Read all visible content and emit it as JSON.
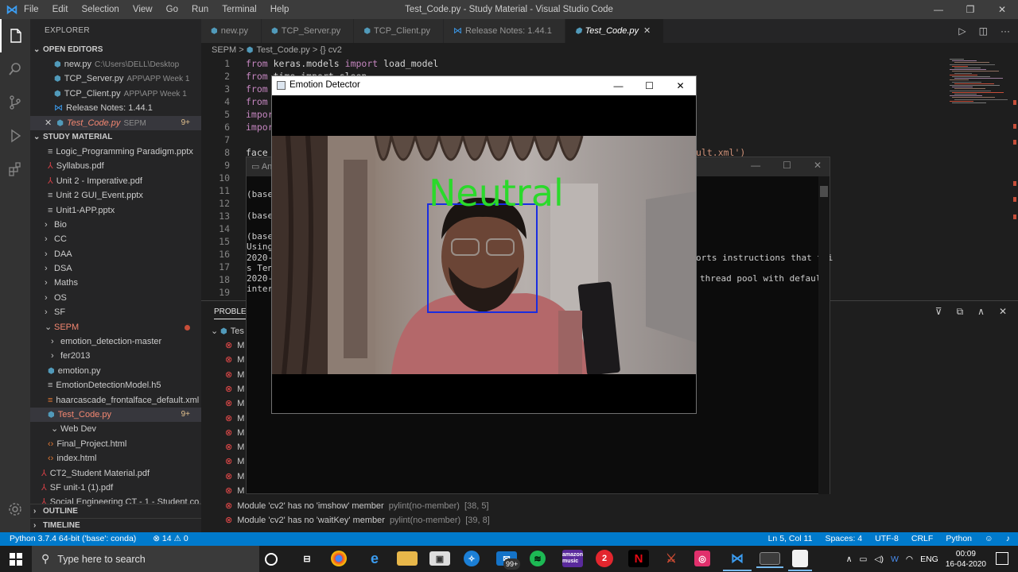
{
  "titlebar": {
    "menu": [
      "File",
      "Edit",
      "Selection",
      "View",
      "Go",
      "Run",
      "Terminal",
      "Help"
    ],
    "title": "Test_Code.py - Study Material - Visual Studio Code",
    "controls": [
      "—",
      "❐",
      "✕"
    ]
  },
  "activity": [
    "files-icon",
    "search-icon",
    "source-control-icon",
    "run-icon",
    "extensions-icon",
    "gear-icon"
  ],
  "sidebar": {
    "header": "EXPLORER",
    "open_editors_title": "OPEN EDITORS",
    "open_editors": [
      {
        "name": "new.py",
        "path": "C:\\Users\\DELL\\Desktop"
      },
      {
        "name": "TCP_Server.py",
        "path": "APP\\APP Week 1"
      },
      {
        "name": "TCP_Client.py",
        "path": "APP\\APP Week 1"
      },
      {
        "name": "Release Notes: 1.44.1",
        "path": ""
      },
      {
        "name": "Test_Code.py",
        "path": "SEPM",
        "badge": "9+"
      }
    ],
    "workspace_title": "STUDY MATERIAL",
    "tree": [
      {
        "label": "Logic_Programming Paradigm.pptx",
        "type": "file"
      },
      {
        "label": "Syllabus.pdf",
        "type": "pdf"
      },
      {
        "label": "Unit 2 - Imperative.pdf",
        "type": "pdf"
      },
      {
        "label": "Unit 2 GUI_Event.pptx",
        "type": "file"
      },
      {
        "label": "Unit1-APP.pptx",
        "type": "file"
      },
      {
        "label": "Bio",
        "type": "folder"
      },
      {
        "label": "CC",
        "type": "folder"
      },
      {
        "label": "DAA",
        "type": "folder"
      },
      {
        "label": "DSA",
        "type": "folder"
      },
      {
        "label": "Maths",
        "type": "folder"
      },
      {
        "label": "OS",
        "type": "folder"
      },
      {
        "label": "SF",
        "type": "folder"
      },
      {
        "label": "SEPM",
        "type": "folder-open"
      },
      {
        "label": "emotion_detection-master",
        "type": "subfolder"
      },
      {
        "label": "fer2013",
        "type": "subfolder"
      },
      {
        "label": "emotion.py",
        "type": "py"
      },
      {
        "label": "EmotionDetectionModel.h5",
        "type": "file"
      },
      {
        "label": "haarcascade_frontalface_default.xml",
        "type": "xml"
      },
      {
        "label": "Test_Code.py",
        "type": "py-sel",
        "badge": "9+"
      },
      {
        "label": "Web Dev",
        "type": "subfolder-open"
      },
      {
        "label": "Final_Project.html",
        "type": "html"
      },
      {
        "label": "index.html",
        "type": "html"
      },
      {
        "label": "CT2_Student Material.pdf",
        "type": "pdf-root"
      },
      {
        "label": "SF unit-1 (1).pdf",
        "type": "pdf-root"
      },
      {
        "label": "Social Engineering CT - 1 - Student co...",
        "type": "pdf-root"
      }
    ],
    "outline": "OUTLINE",
    "timeline": "TIMELINE"
  },
  "tabs": [
    {
      "label": "new.py",
      "icon": "python-icon"
    },
    {
      "label": "TCP_Server.py",
      "icon": "python-icon"
    },
    {
      "label": "TCP_Client.py",
      "icon": "python-icon"
    },
    {
      "label": "Release Notes: 1.44.1",
      "icon": "vscode-icon"
    },
    {
      "label": "Test_Code.py",
      "icon": "python-icon",
      "active": true
    }
  ],
  "breadcrumb": {
    "folder": "SEPM",
    "sep": ">",
    "file": "Test_Code.py",
    "symbol": "{} cv2"
  },
  "editor": {
    "lines": [
      {
        "n": "1",
        "kw": "from",
        "rest": " keras.models ",
        "kw2": "import",
        "rest2": " load_model"
      },
      {
        "n": "2",
        "kw": "from",
        "rest": " time import sleep",
        "kw2": "",
        "rest2": ""
      },
      {
        "n": "3",
        "kw": "from",
        "rest": "",
        "kw2": "",
        "rest2": ""
      },
      {
        "n": "4",
        "kw": "from",
        "rest": "",
        "kw2": "",
        "rest2": ""
      },
      {
        "n": "5",
        "kw": "import",
        "rest": "",
        "kw2": "",
        "rest2": ""
      },
      {
        "n": "6",
        "kw": "import",
        "rest": "",
        "kw2": "",
        "rest2": ""
      },
      {
        "n": "7",
        "kw": "",
        "rest": "",
        "kw2": "",
        "rest2": ""
      },
      {
        "n": "8",
        "kw": "",
        "rest": "face_",
        "kw2": "",
        "rest2": "",
        "str": "ult.xml')"
      },
      {
        "n": "9",
        "kw": "",
        "rest": "",
        "kw2": "",
        "rest2": ""
      },
      {
        "n": "10",
        "kw": "",
        "rest": "",
        "kw2": "",
        "rest2": ""
      },
      {
        "n": "11",
        "kw": "",
        "rest": "",
        "kw2": "",
        "rest2": ""
      },
      {
        "n": "12",
        "kw": "",
        "rest": "",
        "kw2": "",
        "rest2": ""
      },
      {
        "n": "13",
        "kw": "",
        "rest": "",
        "kw2": "",
        "rest2": ""
      },
      {
        "n": "14",
        "kw": "",
        "rest": "",
        "kw2": "",
        "rest2": ""
      },
      {
        "n": "15",
        "kw": "",
        "rest": "",
        "kw2": "",
        "rest2": ""
      },
      {
        "n": "16",
        "kw": "",
        "rest": "",
        "kw2": "",
        "rest2": ""
      },
      {
        "n": "17",
        "kw": "",
        "rest": "",
        "kw2": "",
        "rest2": ""
      },
      {
        "n": "18",
        "kw": "",
        "rest": "",
        "kw2": "",
        "rest2": ""
      },
      {
        "n": "19",
        "kw": "",
        "rest": "",
        "kw2": "",
        "rest2": ""
      }
    ]
  },
  "panel": {
    "tab": "PROBLEMS",
    "group": "Tes",
    "truncated_rows": [
      "M",
      "M",
      "M",
      "M",
      "M",
      "M",
      "M",
      "M",
      "M",
      "M",
      "M"
    ],
    "problems": [
      {
        "msg": "Module 'cv2' has no 'imshow' member",
        "src": "pylint(no-member)",
        "pos": "[38, 5]"
      },
      {
        "msg": "Module 'cv2' has no 'waitKey' member",
        "src": "pylint(no-member)",
        "pos": "[39, 8]"
      }
    ]
  },
  "console": {
    "title": "An",
    "lines": [
      "(base",
      "(base",
      "(base",
      "Using",
      "2020-",
      "s Ten",
      "2020-",
      "inter"
    ],
    "right_fragments": [
      "orts instructions that thi",
      "thread pool with default"
    ]
  },
  "emotion_window": {
    "title": "Emotion Detector",
    "controls": [
      "—",
      "☐",
      "✕"
    ],
    "label": "Neutral",
    "label_color": "#2bd92b",
    "box_color": "#1a2de0"
  },
  "statusbar": {
    "interpreter": "Python 3.7.4 64-bit ('base': conda)",
    "errors": "⊗ 14",
    "warnings": "⚠ 0",
    "position": "Ln 5, Col 11",
    "spaces": "Spaces: 4",
    "encoding": "UTF-8",
    "eol": "CRLF",
    "language": "Python"
  },
  "taskbar": {
    "search_placeholder": "Type here to search",
    "mail_badge": "99+",
    "lang": "ENG",
    "time": "00:09",
    "date": "16-04-2020"
  }
}
